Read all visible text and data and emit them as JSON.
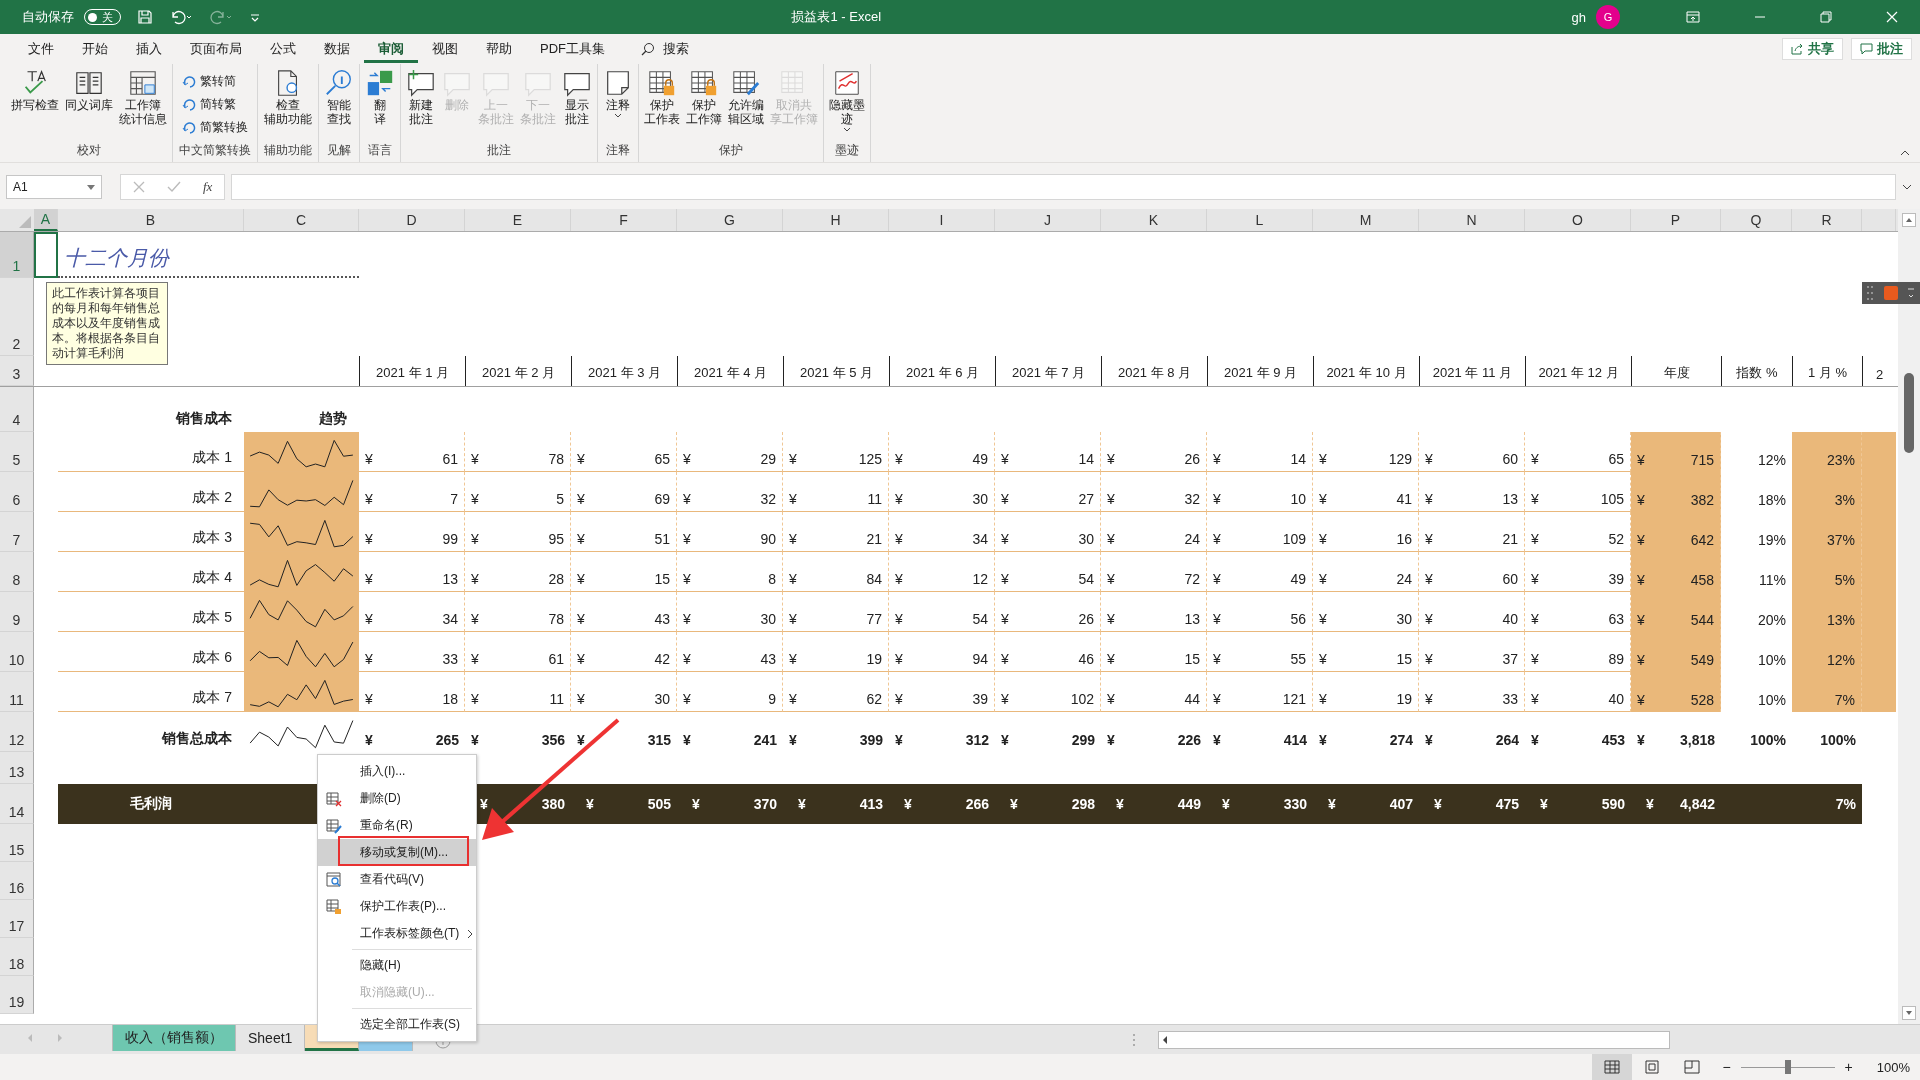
{
  "title_bar": {
    "autosave_label": "自动保存",
    "autosave": {
      "on": false,
      "label": "关"
    },
    "title": "损益表1  -  Excel",
    "user": "gh",
    "avatar": "G"
  },
  "menu_tabs": [
    {
      "label": "文件",
      "selected": false
    },
    {
      "label": "开始",
      "selected": false
    },
    {
      "label": "插入",
      "selected": false
    },
    {
      "label": "页面布局",
      "selected": false
    },
    {
      "label": "公式",
      "selected": false
    },
    {
      "label": "数据",
      "selected": false
    },
    {
      "label": "审阅",
      "selected": true
    },
    {
      "label": "视图",
      "selected": false
    },
    {
      "label": "帮助",
      "selected": false
    },
    {
      "label": "PDF工具集",
      "selected": false
    }
  ],
  "search_label": "搜索",
  "share_button": "共享",
  "comments_button": "批注",
  "ribbon": [
    {
      "label": "校对",
      "buttons": [
        {
          "kind": "large",
          "lines": [
            "拼写检查"
          ],
          "disabled": false
        },
        {
          "kind": "large",
          "lines": [
            "同义词库"
          ],
          "disabled": false
        },
        {
          "kind": "large",
          "lines": [
            "工作簿",
            "统计信息"
          ],
          "disabled": false
        }
      ]
    },
    {
      "label": "中文简繁转换",
      "buttons": [
        {
          "kind": "small",
          "lines": [
            "繁转简"
          ],
          "disabled": false
        },
        {
          "kind": "small",
          "lines": [
            "简转繁"
          ],
          "disabled": false
        },
        {
          "kind": "small",
          "lines": [
            "简繁转换"
          ],
          "disabled": false
        }
      ]
    },
    {
      "label": "辅助功能",
      "buttons": [
        {
          "kind": "large",
          "lines": [
            "检查",
            "辅助功能"
          ],
          "disabled": false
        }
      ]
    },
    {
      "label": "见解",
      "buttons": [
        {
          "kind": "large",
          "lines": [
            "智能",
            "查找"
          ],
          "disabled": false
        }
      ]
    },
    {
      "label": "语言",
      "buttons": [
        {
          "kind": "large",
          "lines": [
            "翻",
            "译"
          ],
          "disabled": false
        }
      ]
    },
    {
      "label": "批注",
      "buttons": [
        {
          "kind": "large",
          "lines": [
            "新建",
            "批注"
          ],
          "disabled": false
        },
        {
          "kind": "large",
          "lines": [
            "删除"
          ],
          "disabled": true
        },
        {
          "kind": "large",
          "lines": [
            "上一",
            "条批注"
          ],
          "disabled": true
        },
        {
          "kind": "large",
          "lines": [
            "下一",
            "条批注"
          ],
          "disabled": true
        },
        {
          "kind": "large",
          "lines": [
            "显示",
            "批注"
          ],
          "disabled": false
        }
      ]
    },
    {
      "label": "注释",
      "buttons": [
        {
          "kind": "large",
          "lines": [
            "注释"
          ],
          "disabled": false,
          "dropdown": true
        }
      ]
    },
    {
      "label": "保护",
      "buttons": [
        {
          "kind": "large",
          "lines": [
            "保护",
            "工作表"
          ],
          "disabled": false
        },
        {
          "kind": "large",
          "lines": [
            "保护",
            "工作簿"
          ],
          "disabled": false
        },
        {
          "kind": "large",
          "lines": [
            "允许编",
            "辑区域"
          ],
          "disabled": false
        },
        {
          "kind": "large",
          "lines": [
            "取消共",
            "享工作簿"
          ],
          "disabled": true
        }
      ]
    },
    {
      "label": "墨迹",
      "buttons": [
        {
          "kind": "large",
          "lines": [
            "隐藏墨",
            "迹"
          ],
          "disabled": false,
          "dropdown": true
        }
      ]
    }
  ],
  "formula_bar": {
    "name_box": "A1",
    "function_label": "fx"
  },
  "sheet": {
    "columns": [
      "A",
      "B",
      "C",
      "D",
      "E",
      "F",
      "G",
      "H",
      "I",
      "J",
      "K",
      "L",
      "M",
      "N",
      "O",
      "P",
      "Q",
      "R"
    ],
    "rows": [
      "1",
      "2",
      "3",
      "4",
      "5",
      "6",
      "7",
      "8",
      "9",
      "10",
      "11",
      "12",
      "13",
      "14",
      "15",
      "16",
      "17",
      "18",
      "19"
    ],
    "title": "十二个月份",
    "comment": "此工作表计算各项目的每月和每年销售总成本以及年度销售成本。将根据各条目自动计算毛利润",
    "headers": [
      "2021 年 1 月",
      "2021 年 2 月",
      "2021 年 3 月",
      "2021 年 4 月",
      "2021 年 5 月",
      "2021 年 6 月",
      "2021 年 7 月",
      "2021 年 8 月",
      "2021 年 9 月",
      "2021 年 10 月",
      "2021 年 11 月",
      "2021 年 12 月"
    ],
    "annual_header": "年度",
    "index_header": "指数 %",
    "month_pct_header": "1 月 %",
    "next_header": "2",
    "section_header": "销售成本",
    "trend_header": "趋势",
    "cost_rows": [
      {
        "label": "成本 1",
        "values": [
          [
            "¥",
            "61"
          ],
          [
            "¥",
            "78"
          ],
          [
            "¥",
            "65"
          ],
          [
            "¥",
            "29"
          ],
          [
            "¥",
            "125"
          ],
          [
            "¥",
            "49"
          ],
          [
            "¥",
            "14"
          ],
          [
            "¥",
            "26"
          ],
          [
            "¥",
            "14"
          ],
          [
            "¥",
            "129"
          ],
          [
            "¥",
            "60"
          ],
          [
            "¥",
            "65"
          ]
        ],
        "annual": [
          "¥",
          "715"
        ],
        "index": "12%",
        "month_pct": "23%"
      },
      {
        "label": "成本 2",
        "values": [
          [
            "¥",
            "7"
          ],
          [
            "¥",
            "5"
          ],
          [
            "¥",
            "69"
          ],
          [
            "¥",
            "32"
          ],
          [
            "¥",
            "11"
          ],
          [
            "¥",
            "30"
          ],
          [
            "¥",
            "27"
          ],
          [
            "¥",
            "32"
          ],
          [
            "¥",
            "10"
          ],
          [
            "¥",
            "41"
          ],
          [
            "¥",
            "13"
          ],
          [
            "¥",
            "105"
          ]
        ],
        "annual": [
          "¥",
          "382"
        ],
        "index": "18%",
        "month_pct": "3%"
      },
      {
        "label": "成本 3",
        "values": [
          [
            "¥",
            "99"
          ],
          [
            "¥",
            "95"
          ],
          [
            "¥",
            "51"
          ],
          [
            "¥",
            "90"
          ],
          [
            "¥",
            "21"
          ],
          [
            "¥",
            "34"
          ],
          [
            "¥",
            "30"
          ],
          [
            "¥",
            "24"
          ],
          [
            "¥",
            "109"
          ],
          [
            "¥",
            "16"
          ],
          [
            "¥",
            "21"
          ],
          [
            "¥",
            "52"
          ]
        ],
        "annual": [
          "¥",
          "642"
        ],
        "index": "19%",
        "month_pct": "37%"
      },
      {
        "label": "成本 4",
        "values": [
          [
            "¥",
            "13"
          ],
          [
            "¥",
            "28"
          ],
          [
            "¥",
            "15"
          ],
          [
            "¥",
            "8"
          ],
          [
            "¥",
            "84"
          ],
          [
            "¥",
            "12"
          ],
          [
            "¥",
            "54"
          ],
          [
            "¥",
            "72"
          ],
          [
            "¥",
            "49"
          ],
          [
            "¥",
            "24"
          ],
          [
            "¥",
            "60"
          ],
          [
            "¥",
            "39"
          ]
        ],
        "annual": [
          "¥",
          "458"
        ],
        "index": "11%",
        "month_pct": "5%"
      },
      {
        "label": "成本 5",
        "values": [
          [
            "¥",
            "34"
          ],
          [
            "¥",
            "78"
          ],
          [
            "¥",
            "43"
          ],
          [
            "¥",
            "30"
          ],
          [
            "¥",
            "77"
          ],
          [
            "¥",
            "54"
          ],
          [
            "¥",
            "26"
          ],
          [
            "¥",
            "13"
          ],
          [
            "¥",
            "56"
          ],
          [
            "¥",
            "30"
          ],
          [
            "¥",
            "40"
          ],
          [
            "¥",
            "63"
          ]
        ],
        "annual": [
          "¥",
          "544"
        ],
        "index": "20%",
        "month_pct": "13%"
      },
      {
        "label": "成本 6",
        "values": [
          [
            "¥",
            "33"
          ],
          [
            "¥",
            "61"
          ],
          [
            "¥",
            "42"
          ],
          [
            "¥",
            "43"
          ],
          [
            "¥",
            "19"
          ],
          [
            "¥",
            "94"
          ],
          [
            "¥",
            "46"
          ],
          [
            "¥",
            "15"
          ],
          [
            "¥",
            "55"
          ],
          [
            "¥",
            "15"
          ],
          [
            "¥",
            "37"
          ],
          [
            "¥",
            "89"
          ]
        ],
        "annual": [
          "¥",
          "549"
        ],
        "index": "10%",
        "month_pct": "12%"
      },
      {
        "label": "成本 7",
        "values": [
          [
            "¥",
            "18"
          ],
          [
            "¥",
            "11"
          ],
          [
            "¥",
            "30"
          ],
          [
            "¥",
            "9"
          ],
          [
            "¥",
            "62"
          ],
          [
            "¥",
            "39"
          ],
          [
            "¥",
            "102"
          ],
          [
            "¥",
            "44"
          ],
          [
            "¥",
            "121"
          ],
          [
            "¥",
            "19"
          ],
          [
            "¥",
            "33"
          ],
          [
            "¥",
            "40"
          ]
        ],
        "annual": [
          "¥",
          "528"
        ],
        "index": "10%",
        "month_pct": "7%"
      }
    ],
    "total_row": {
      "label": "销售总成本",
      "values": [
        [
          "¥",
          "265"
        ],
        [
          "¥",
          "356"
        ],
        [
          "¥",
          "315"
        ],
        [
          "¥",
          "241"
        ],
        [
          "¥",
          "399"
        ],
        [
          "¥",
          "312"
        ],
        [
          "¥",
          "299"
        ],
        [
          "¥",
          "226"
        ],
        [
          "¥",
          "414"
        ],
        [
          "¥",
          "274"
        ],
        [
          "¥",
          "264"
        ],
        [
          "¥",
          "453"
        ]
      ],
      "annual": [
        "¥",
        "3,818"
      ],
      "index": "100%",
      "month_pct": "100%"
    },
    "profit_row": {
      "label": "毛利润",
      "values": [
        [
          "¥",
          "380"
        ],
        [
          "¥",
          "505"
        ],
        [
          "¥",
          "370"
        ],
        [
          "¥",
          "413"
        ],
        [
          "¥",
          "266"
        ],
        [
          "¥",
          "298"
        ],
        [
          "¥",
          "449"
        ],
        [
          "¥",
          "330"
        ],
        [
          "¥",
          "407"
        ],
        [
          "¥",
          "475"
        ],
        [
          "¥",
          "590"
        ]
      ],
      "annual": [
        "¥",
        "4,842"
      ],
      "month_pct": "7%"
    }
  },
  "context_menu": [
    {
      "label": "插入(I)...",
      "kind": "plain",
      "selected": false,
      "disabled": false
    },
    {
      "label": "删除(D)",
      "kind": "delete",
      "selected": false,
      "disabled": false
    },
    {
      "label": "重命名(R)",
      "kind": "rename",
      "selected": false,
      "disabled": false
    },
    {
      "label": "移动或复制(M)...",
      "kind": "plain",
      "selected": true,
      "disabled": false
    },
    {
      "label": "查看代码(V)",
      "kind": "code",
      "selected": false,
      "disabled": false
    },
    {
      "label": "保护工作表(P)...",
      "kind": "protect",
      "selected": false,
      "disabled": false
    },
    {
      "label": "工作表标签颜色(T)",
      "kind": "submenu",
      "selected": false,
      "disabled": false
    },
    {
      "label": "隐藏(H)",
      "kind": "plain",
      "selected": false,
      "disabled": false,
      "separator_before": true
    },
    {
      "label": "取消隐藏(U)...",
      "kind": "plain",
      "selected": false,
      "disabled": true
    },
    {
      "label": "选定全部工作表(S)",
      "kind": "plain",
      "selected": false,
      "disabled": false,
      "separator_before": true
    }
  ],
  "sheet_tabs": [
    {
      "label": "收入（销售额）",
      "color": "#6ec7b0",
      "selected": false
    },
    {
      "label": "Sheet1",
      "selected": false
    },
    {
      "color": "#f7dcb6",
      "selected": true
    },
    {
      "color": "#8fc9ea",
      "selected": false
    }
  ],
  "status_bar": {
    "views": [
      {
        "selected": true
      },
      {
        "selected": false
      },
      {
        "selected": false
      }
    ],
    "zoom_out": "−",
    "zoom_in": "+",
    "zoom": {
      "level": 0.5
    },
    "zoom_label": "100%"
  }
}
